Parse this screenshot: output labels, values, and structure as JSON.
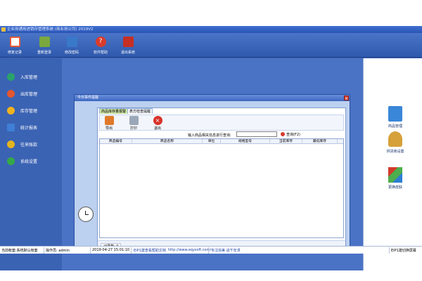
{
  "window": {
    "title": "企业用通用进销存管理系统 (商业用公司) 2019V2"
  },
  "toolbar": [
    {
      "label": "修复记录",
      "color": "#e45a3a"
    },
    {
      "label": "重新登录",
      "color": "#7aa83e"
    },
    {
      "label": "修改密码",
      "color": "#3a78c9"
    },
    {
      "label": "软件帮助",
      "color": "#d93c2c"
    },
    {
      "label": "退出系统",
      "color": "#c62f24"
    }
  ],
  "nav": [
    {
      "label": "入库管理",
      "color": "#29a36a"
    },
    {
      "label": "出库管理",
      "color": "#e4572e"
    },
    {
      "label": "库存管理",
      "color": "#f0b21e"
    },
    {
      "label": "统计报表",
      "color": "#3f7fd6"
    },
    {
      "label": "往来账款",
      "color": "#e2b420"
    },
    {
      "label": "系统设置",
      "color": "#36a848"
    }
  ],
  "right": [
    {
      "label": "商品管理",
      "color": "#3a86d8"
    },
    {
      "label": "供货商设置",
      "color": "#d6a03a"
    },
    {
      "label": "更换皮肤",
      "color": "#4cae4c"
    }
  ],
  "dialog": {
    "title": "今日事件提醒",
    "close": "x",
    "tabs": [
      "商品库存量报警",
      "表方检查提醒"
    ],
    "actions": [
      {
        "label": "导出",
        "color": "#e07a2a"
      },
      {
        "label": "打印",
        "color": "#9aa7b8"
      },
      {
        "label": "退出",
        "color": "#d8322a"
      }
    ],
    "search_label": "输入商品相关信息进行查询:",
    "search_value": "",
    "search_button": "查询(F2)",
    "columns": [
      "商品编号",
      "商品名称",
      "单位",
      "规格型号",
      "当前库存",
      "最低库存"
    ],
    "record_count": "记录数: 0"
  },
  "status": {
    "user": "当前帐套:系统默认帐套",
    "operator": "操作员: admin",
    "datetime": "2019-04-27 15:01:10",
    "help": "EIP1建查看帮助文档",
    "url": "http://www.eqysoft.com/",
    "slogan": "专注完美 话千年求",
    "right": "EIP1建切换屏幕"
  },
  "colors": {
    "frame_blue": "#3b63b4",
    "panel_blue": "#4a72c5"
  }
}
